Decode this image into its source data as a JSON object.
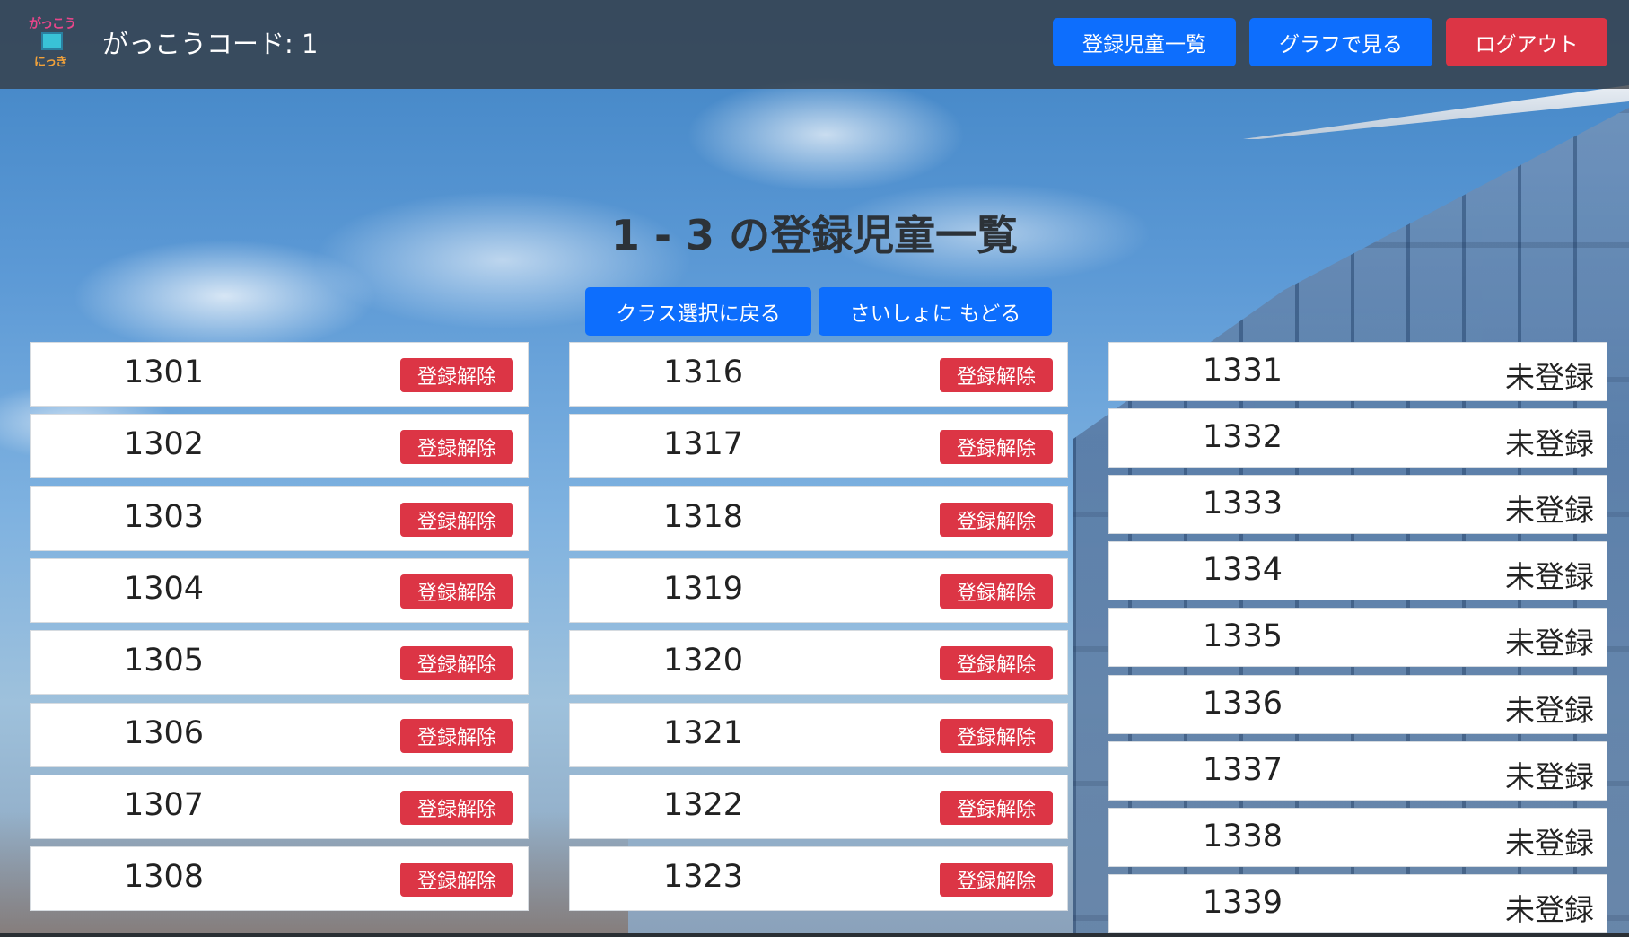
{
  "header": {
    "logo_text_top": "がっこう",
    "logo_text_bottom": "にっき",
    "school_code": "がっこうコード: 1",
    "buttons": {
      "student_list": "登録児童一覧",
      "graph": "グラフで見る",
      "logout": "ログアウト"
    }
  },
  "page": {
    "title": "1 - 3 の登録児童一覧",
    "back_to_class": "クラス選択に戻る",
    "back_to_start": "さいしょに もどる"
  },
  "unregister_label": "登録解除",
  "unregistered_status": "未登録",
  "columns": [
    {
      "students": [
        "1301",
        "1302",
        "1303",
        "1304",
        "1305",
        "1306",
        "1307",
        "1308"
      ]
    },
    {
      "students": [
        "1316",
        "1317",
        "1318",
        "1319",
        "1320",
        "1321",
        "1322",
        "1323"
      ]
    },
    {
      "students": [
        "1331",
        "1332",
        "1333",
        "1334",
        "1335",
        "1336",
        "1337",
        "1338",
        "1339"
      ]
    }
  ]
}
